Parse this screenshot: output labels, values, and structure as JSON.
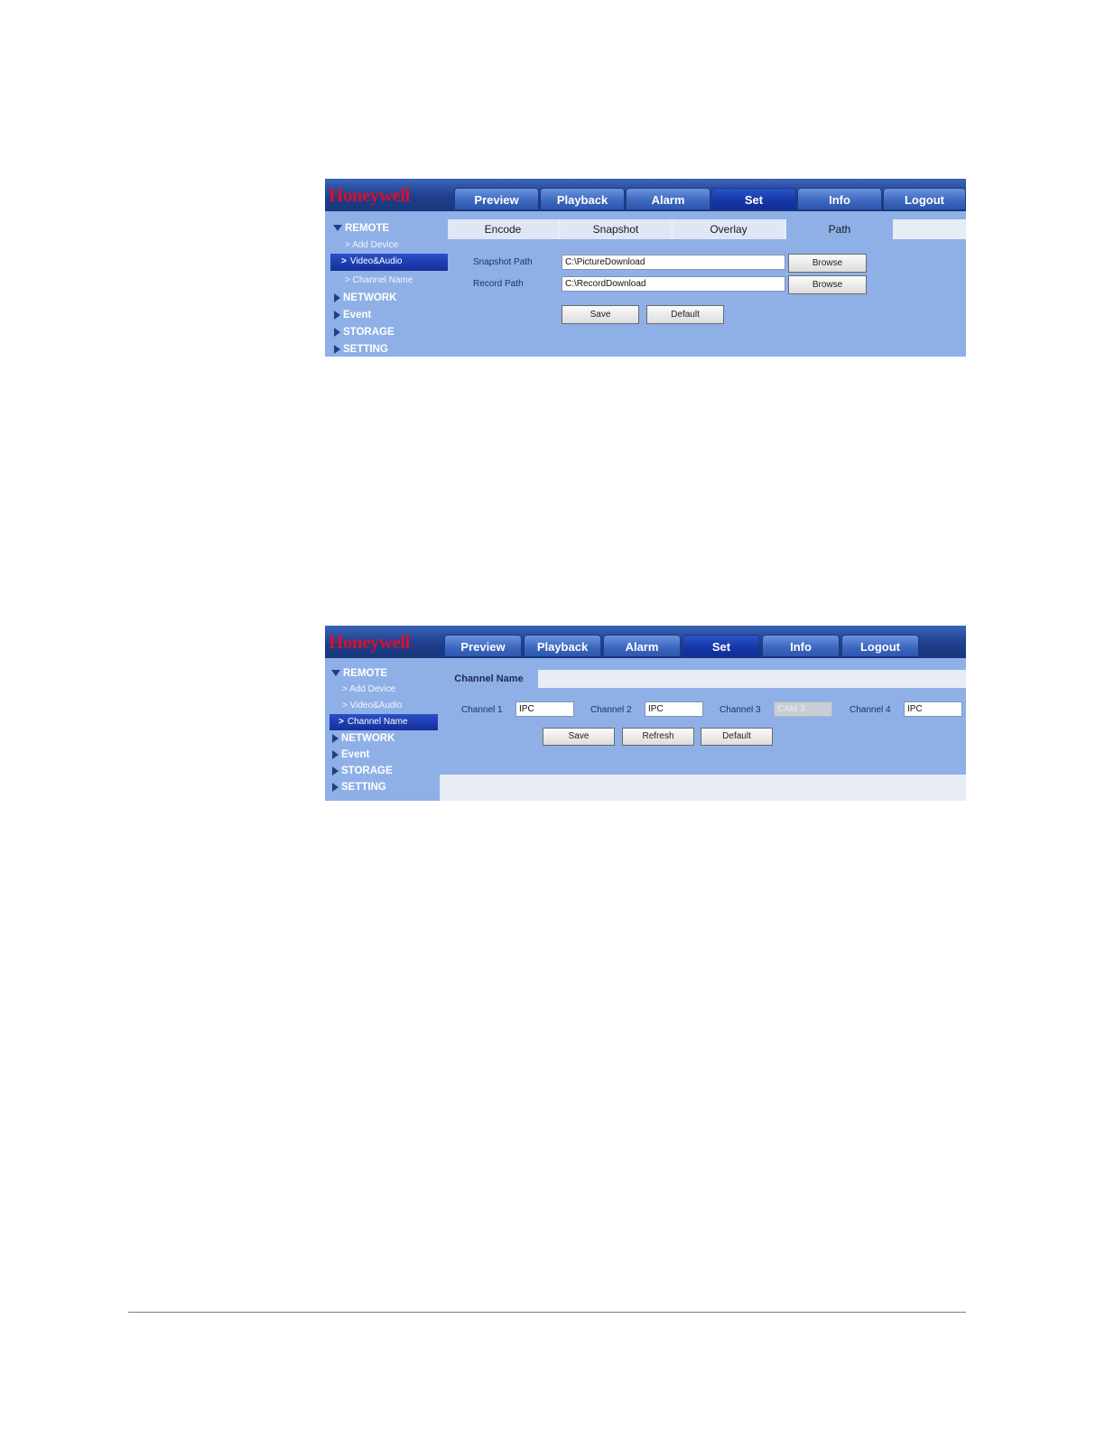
{
  "screen1": {
    "logo": "Honeywell",
    "nav": [
      "Preview",
      "Playback",
      "Alarm",
      "Set",
      "Info",
      "Logout"
    ],
    "active_nav": "Set",
    "sidebar": {
      "remote": "REMOTE",
      "sub": [
        "> Add Device",
        "Video&Audio",
        "> Channel Name"
      ],
      "selected_sub": "Video&Audio",
      "sections": [
        "NETWORK",
        "Event",
        "STORAGE",
        "SETTING"
      ]
    },
    "tabs": [
      "Encode",
      "Snapshot",
      "Overlay",
      "Path"
    ],
    "active_tab": "Path",
    "snapshot_path_label": "Snapshot Path",
    "snapshot_path_value": "C:\\PictureDownload",
    "record_path_label": "Record Path",
    "record_path_value": "C:\\RecordDownload",
    "browse_label": "Browse",
    "save_label": "Save",
    "default_label": "Default"
  },
  "screen2": {
    "logo": "Honeywell",
    "nav": [
      "Preview",
      "Playback",
      "Alarm",
      "Set",
      "Info",
      "Logout"
    ],
    "active_nav": "Set",
    "sidebar": {
      "remote": "REMOTE",
      "sub": [
        "> Add Device",
        "> Video&Audio",
        "Channel Name"
      ],
      "selected_sub": "Channel Name",
      "sections": [
        "NETWORK",
        "Event",
        "STORAGE",
        "SETTING"
      ]
    },
    "tab_title": "Channel Name",
    "channels": [
      {
        "label": "Channel 1",
        "value": "IPC",
        "disabled": false
      },
      {
        "label": "Channel 2",
        "value": "IPC",
        "disabled": false
      },
      {
        "label": "Channel 3",
        "value": "CAM 3",
        "disabled": true
      },
      {
        "label": "Channel 4",
        "value": "IPC",
        "disabled": false
      }
    ],
    "save_label": "Save",
    "refresh_label": "Refresh",
    "default_label": "Default"
  }
}
